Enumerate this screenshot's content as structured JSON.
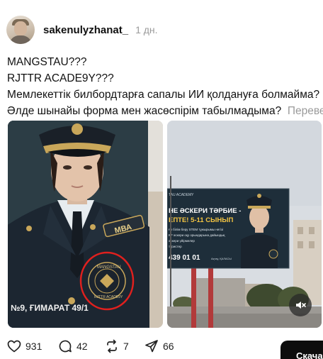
{
  "post": {
    "username": "sakenulyzhanat_",
    "time": "1 дн.",
    "lines": [
      "MANGSTAU???",
      "RJTTR ACADE9Y???",
      "Мемлекеттік билбордтарға сапалы ИИ қолдануға болмайма?",
      "Әлде шынайы форма мен жасөспірім табылмадыма?"
    ],
    "translate_label": "Перевест"
  },
  "image_left": {
    "badge_text": "МВА",
    "emblem_text_top": "MANGSTAU",
    "emblem_text_bottom": "RJTTR ACADE9Y",
    "address": "№9, ҒИМАРАТ 49/1"
  },
  "image_right": {
    "board_top": "TAU ACADEMY",
    "board_headline_1": "НЕ ӘСКЕРИ ТӘРБИЕ -",
    "board_headline_2": "ЕПТЕ! 5-11 СЫНЫП",
    "board_line_1": "ғы білім беру STEM тұжырымы негізі",
    "board_line_2": "ҚР әскери оқу орындарына дайындық",
    "board_line_3": "әскери үйірмелер",
    "board_line_4": "туристер",
    "board_phone": "439 01 01",
    "board_small": "Ақтау, ҚАЛАСЫ"
  },
  "actions": {
    "likes": "931",
    "comments": "42",
    "reposts": "7",
    "shares": "66",
    "dark_button": "Скачать"
  }
}
